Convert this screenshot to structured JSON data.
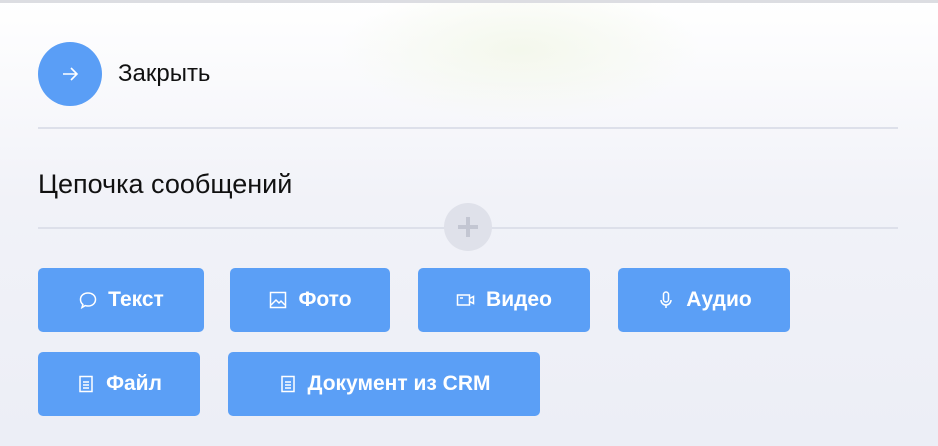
{
  "close": {
    "label": "Закрыть"
  },
  "section": {
    "title": "Цепочка сообщений"
  },
  "buttons": [
    {
      "label": "Текст",
      "icon": "chat-bubble-icon"
    },
    {
      "label": "Фото",
      "icon": "image-icon"
    },
    {
      "label": "Видео",
      "icon": "video-camera-icon"
    },
    {
      "label": "Аудио",
      "icon": "microphone-icon"
    },
    {
      "label": "Файл",
      "icon": "document-icon"
    },
    {
      "label": "Документ из CRM",
      "icon": "document-icon"
    }
  ],
  "colors": {
    "accent": "#5b9ff6"
  }
}
